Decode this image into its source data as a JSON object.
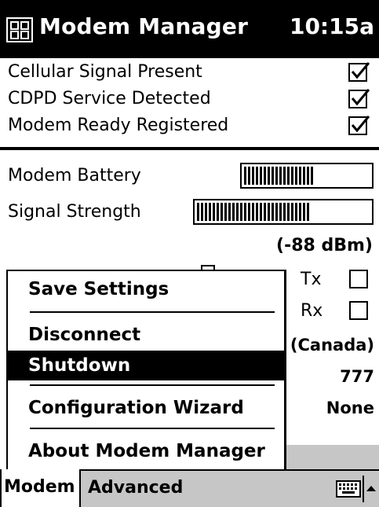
{
  "titlebar": {
    "app_title": "Modem Manager",
    "time": "10:15a",
    "icon": "modem-manager-app-icon"
  },
  "status": [
    {
      "label": "Cellular Signal Present",
      "checked": true
    },
    {
      "label": "CDPD Service Detected",
      "checked": true
    },
    {
      "label": "Modem Ready Registered",
      "checked": true
    }
  ],
  "meters": {
    "battery_label": "Modem Battery",
    "battery_level": 0.55,
    "signal_label": "Signal Strength",
    "signal_level": 0.66,
    "signal_dbm": "(-88 dBm)"
  },
  "tx_rx": {
    "tx_label": "Tx",
    "rx_label": "Rx",
    "tx_checked": false,
    "rx_checked": false
  },
  "network": {
    "carrier_partial": "s (Canada)",
    "code": "777",
    "value": "None"
  },
  "popup_menu": {
    "items": [
      {
        "label": "Save Settings",
        "selected": false
      },
      {
        "label": "Disconnect",
        "selected": false
      },
      {
        "label": "Shutdown",
        "selected": true
      },
      {
        "label": "Configuration Wizard",
        "selected": false
      },
      {
        "label": "About Modem Manager",
        "selected": false
      }
    ]
  },
  "menubar": {
    "modem_label": "Modem",
    "advanced_label": "Advanced",
    "keyboard_icon": "keyboard-icon",
    "sip_arrow_icon": "up-arrow-icon"
  },
  "colors": {
    "titlebar_bg": "#000000",
    "menubar_bg": "#c6c6c6",
    "selection_bg": "#000000"
  }
}
